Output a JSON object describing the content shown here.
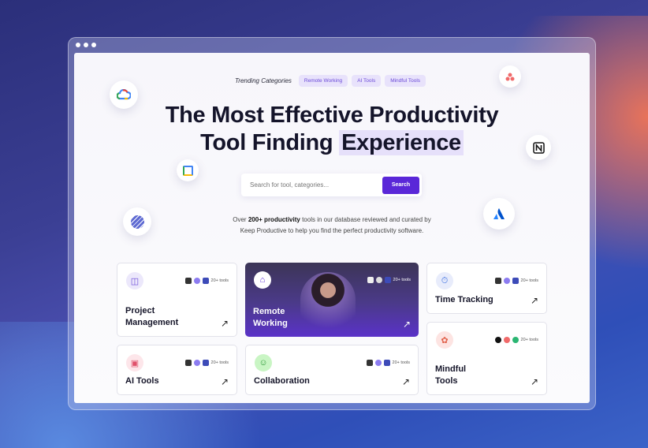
{
  "trending": {
    "label": "Trending Categories",
    "chips": [
      "Remote Working",
      "AI Tools",
      "Mindful Tools"
    ]
  },
  "hero": {
    "line1": "The Most Effective Productivity",
    "line2_prefix": "Tool Finding",
    "line2_highlight": "Experience"
  },
  "search": {
    "placeholder": "Search for tool, categories...",
    "button": "Search"
  },
  "description": {
    "prefix": "Over",
    "bold": "200+ productivity",
    "suffix": "tools in our database reviewed and curated by",
    "line2": "Keep Productive to help you find the perfect productivity software."
  },
  "floating_icons": [
    "google-cloud-icon",
    "google-calendar-icon",
    "linear-icon",
    "asana-icon",
    "notion-icon",
    "atlassian-icon"
  ],
  "cards": [
    {
      "title": "Project Management",
      "tools": "20+ tools",
      "icon": "clipboard-icon",
      "color": "#ece8fb"
    },
    {
      "title": "Remote Working",
      "tools": "20+ tools",
      "icon": "home-icon",
      "color": "#ffffff"
    },
    {
      "title": "Time Tracking",
      "tools": "20+ tools",
      "icon": "stopwatch-icon",
      "color": "#e8ecfb"
    },
    {
      "title": "AI Tools",
      "tools": "20+ tools",
      "icon": "robot-icon",
      "color": "#fde6ea"
    },
    {
      "title": "Collaboration",
      "tools": "20+ tools",
      "icon": "team-icon",
      "color": "#c9f5c4"
    },
    {
      "title": "Mindful Tools",
      "tools": "20+ tools",
      "icon": "brain-icon",
      "color": "#fde4e2"
    }
  ],
  "accent": "#5a27d8"
}
